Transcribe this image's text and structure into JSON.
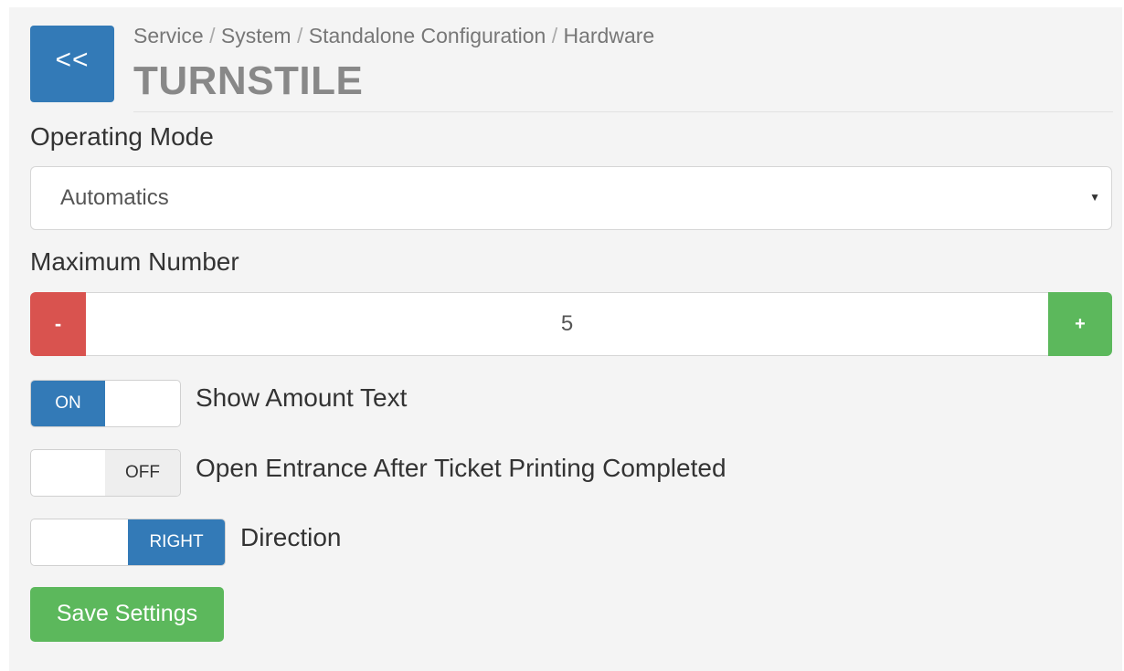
{
  "header": {
    "back_label": "<<",
    "breadcrumb": [
      "Service",
      "System",
      "Standalone Configuration",
      "Hardware"
    ],
    "breadcrumb_separator": "/",
    "title": "TURNSTILE"
  },
  "operating_mode": {
    "label": "Operating Mode",
    "selected": "Automatics"
  },
  "maximum_number": {
    "label": "Maximum Number",
    "minus_label": "-",
    "value": "5",
    "plus_label": "+"
  },
  "toggles": [
    {
      "state_label": "ON",
      "checked": true,
      "label": "Show Amount Text"
    },
    {
      "state_label": "OFF",
      "checked": false,
      "label": "Open Entrance After Ticket Printing Completed"
    },
    {
      "state_label": "RIGHT",
      "checked": true,
      "label": "Direction"
    }
  ],
  "save_label": "Save Settings",
  "colors": {
    "primary": "#337ab7",
    "success": "#5cb85c",
    "danger": "#d9534f",
    "panel_background": "#f4f4f4"
  }
}
